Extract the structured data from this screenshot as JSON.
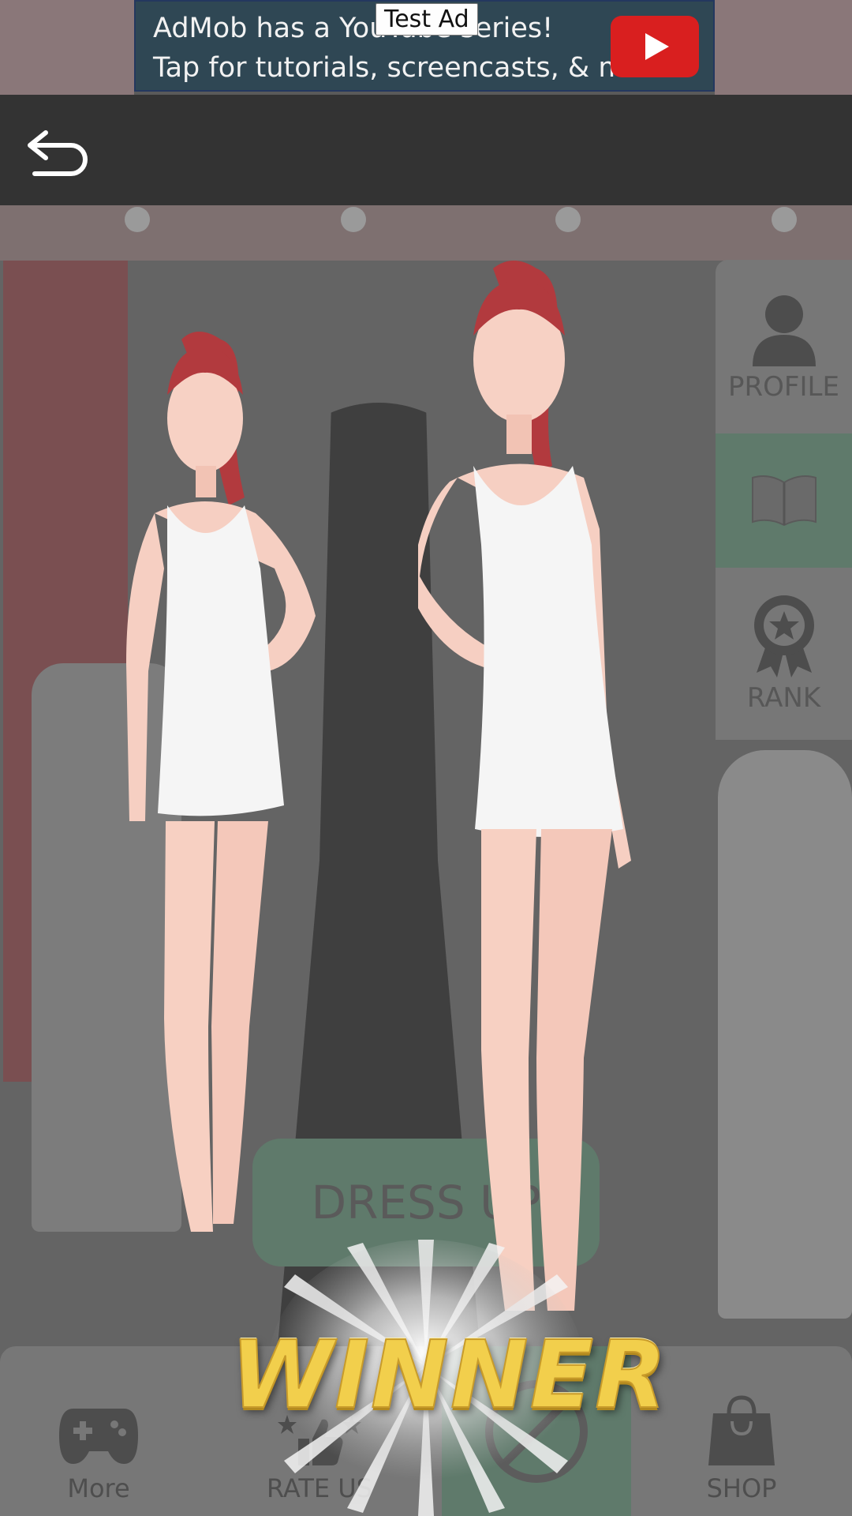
{
  "ad": {
    "line1": "AdMob has a YouTube series!",
    "line2": "Tap for tutorials, screencasts, & more.",
    "label": "Test Ad",
    "play_icon": "youtube-play-icon"
  },
  "top_bar": {
    "back_icon": "back-arrow-icon"
  },
  "side_panel": {
    "items": [
      {
        "label": "PROFILE",
        "icon": "profile-icon"
      },
      {
        "label": "",
        "icon": "book-icon"
      },
      {
        "label": "RANK",
        "icon": "rank-badge-icon"
      }
    ]
  },
  "main": {
    "dress_up_label": "DRESS UP",
    "winner_text": "WINNER"
  },
  "bottom_nav": {
    "items": [
      {
        "label": "More",
        "icon": "gamepad-icon"
      },
      {
        "label": "RATE US",
        "icon": "thumbs-up-icon"
      },
      {
        "label": "",
        "icon": "no-ads-icon"
      },
      {
        "label": "SHOP",
        "icon": "shopping-bag-icon"
      }
    ]
  },
  "colors": {
    "top_bar": "#333333",
    "winner_gold": "#f2cf4c",
    "no_ads_green": "#5f7a6b"
  }
}
